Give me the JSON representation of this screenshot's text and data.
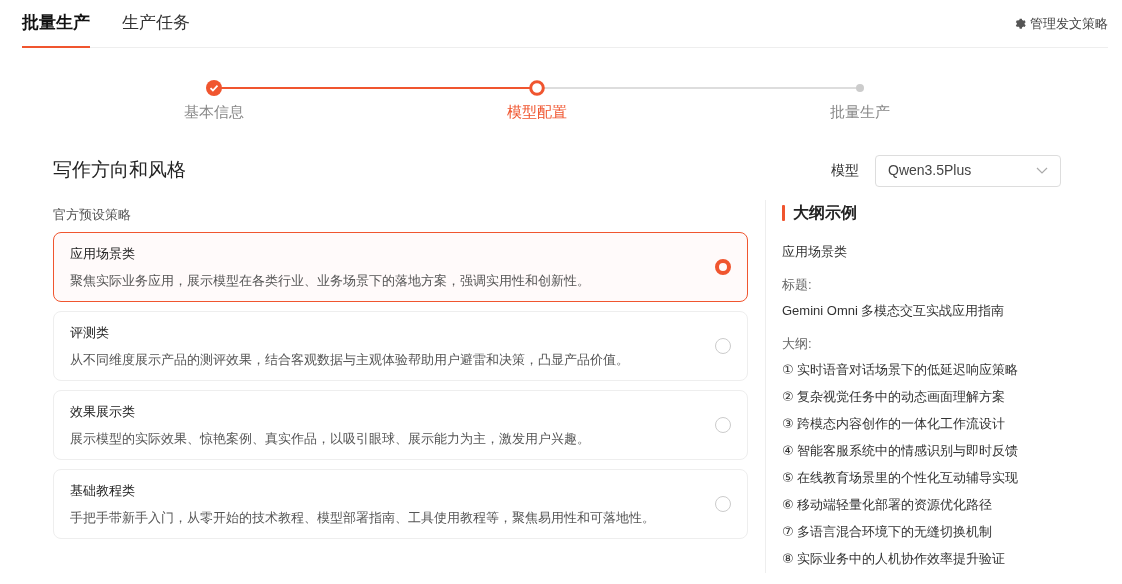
{
  "tabs": [
    {
      "label": "批量生产",
      "selected": true
    },
    {
      "label": "生产任务",
      "selected": false
    }
  ],
  "manage_link": "管理发文策略",
  "steps": [
    {
      "label": "基本信息",
      "done": true,
      "selected": false
    },
    {
      "label": "模型配置",
      "done": false,
      "selected": true
    },
    {
      "label": "批量生产",
      "done": false,
      "selected": false
    }
  ],
  "section_title": "写作方向和风格",
  "model": {
    "label": "模型",
    "value": "Qwen3.5Plus"
  },
  "presets_label": "官方预设策略",
  "presets": [
    {
      "title": "应用场景类",
      "description": "聚焦实际业务应用，展示模型在各类行业、业务场景下的落地方案，强调实用性和创新性。",
      "selected": true
    },
    {
      "title": "评测类",
      "description": "从不同维度展示产品的测评效果，结合客观数据与主观体验帮助用户避雷和决策，凸显产品价值。",
      "selected": false
    },
    {
      "title": "效果展示类",
      "description": "展示模型的实际效果、惊艳案例、真实作品，以吸引眼球、展示能力为主，激发用户兴趣。",
      "selected": false
    },
    {
      "title": "基础教程类",
      "description": "手把手带新手入门，从零开始的技术教程、模型部署指南、工具使用教程等，聚焦易用性和可落地性。",
      "selected": false
    }
  ],
  "outline_example": {
    "heading": "大纲示例",
    "category": "应用场景类",
    "title_label": "标题:",
    "title": "Gemini Omni 多模态交互实战应用指南",
    "outline_label": "大纲:",
    "items": [
      "① 实时语音对话场景下的低延迟响应策略",
      "② 复杂视觉任务中的动态画面理解方案",
      "③ 跨模态内容创作的一体化工作流设计",
      "④ 智能客服系统中的情感识别与即时反馈",
      "⑤ 在线教育场景里的个性化互动辅导实现",
      "⑥ 移动端轻量化部署的资源优化路径",
      "⑦ 多语言混合环境下的无缝切换机制",
      "⑧ 实际业务中的人机协作效率提升验证"
    ]
  }
}
